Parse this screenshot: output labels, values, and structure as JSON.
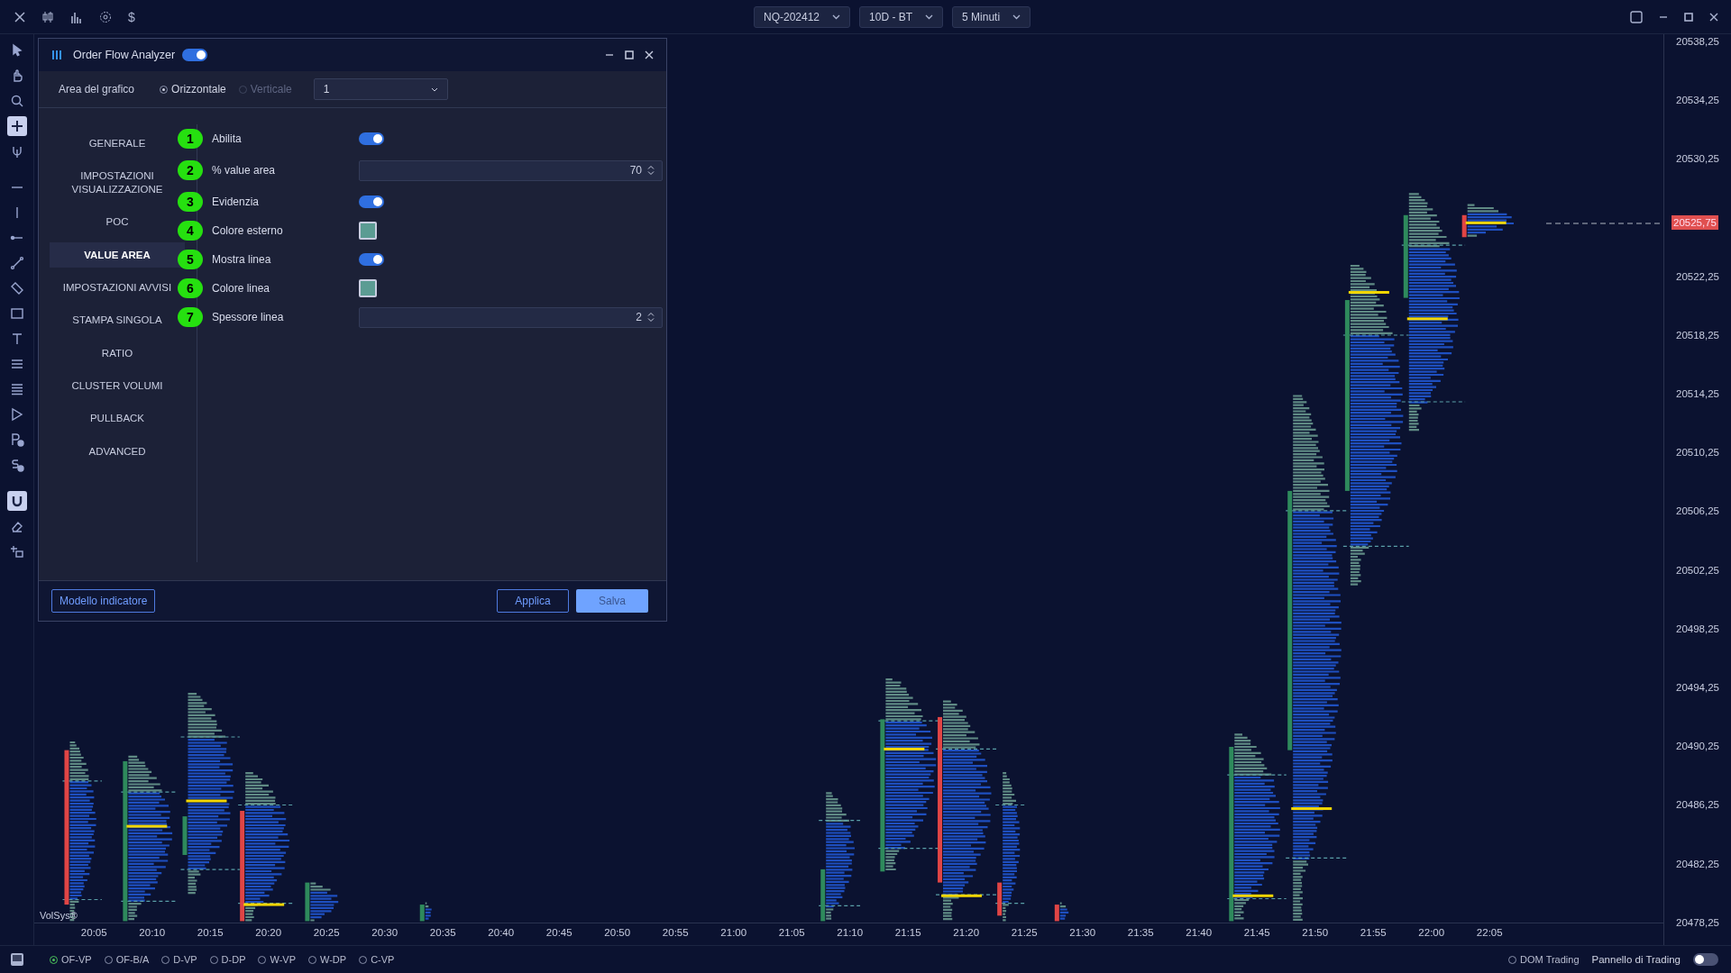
{
  "topbar": {
    "currency_symbol": "$",
    "selectors": [
      {
        "label": "NQ-202412"
      },
      {
        "label": "10D - BT"
      },
      {
        "label": "5 Minuti"
      }
    ]
  },
  "drawing_tools": [
    {
      "kind": "cursor",
      "selected": false
    },
    {
      "kind": "hand",
      "selected": false
    },
    {
      "kind": "zoom",
      "selected": false
    },
    {
      "kind": "crosshair",
      "selected": true
    },
    {
      "kind": "fork",
      "selected": false
    },
    {
      "kind": "hline",
      "selected": false
    },
    {
      "kind": "vline",
      "selected": false
    },
    {
      "kind": "ray",
      "selected": false
    },
    {
      "kind": "trendline",
      "selected": false
    },
    {
      "kind": "channel",
      "selected": false
    },
    {
      "kind": "rectangle",
      "selected": false
    },
    {
      "kind": "text",
      "selected": false
    },
    {
      "kind": "lines3",
      "selected": false
    },
    {
      "kind": "lines4",
      "selected": false
    },
    {
      "kind": "profile",
      "selected": false
    },
    {
      "kind": "price-note",
      "selected": false
    },
    {
      "kind": "s-note",
      "selected": false
    },
    {
      "kind": "magnet",
      "selected": true
    },
    {
      "kind": "eraser",
      "selected": false
    },
    {
      "kind": "clone",
      "selected": false
    }
  ],
  "dialog": {
    "title": "Order Flow Analyzer",
    "enabled": true,
    "area_label": "Area del grafico",
    "orientation": [
      {
        "label": "Orizzontale",
        "selected": true,
        "disabled": false
      },
      {
        "label": "Verticale",
        "selected": false,
        "disabled": true
      }
    ],
    "pane": "1",
    "sections": [
      {
        "label": "GENERALE",
        "selected": false
      },
      {
        "label": "IMPOSTAZIONI VISUALIZZAZIONE",
        "selected": false
      },
      {
        "label": "POC",
        "selected": false
      },
      {
        "label": "VALUE AREA",
        "selected": true
      },
      {
        "label": "IMPOSTAZIONI AVVISI",
        "selected": false
      },
      {
        "label": "STAMPA SINGOLA",
        "selected": false
      },
      {
        "label": "RATIO",
        "selected": false
      },
      {
        "label": "CLUSTER VOLUMI",
        "selected": false
      },
      {
        "label": "PULLBACK",
        "selected": false
      },
      {
        "label": "ADVANCED",
        "selected": false
      }
    ],
    "settings": [
      {
        "number": "1",
        "label": "Abilita",
        "kind": "toggle",
        "on": true
      },
      {
        "number": "2",
        "label": "% value area",
        "kind": "number",
        "value": "70"
      },
      {
        "number": "3",
        "label": "Evidenzia",
        "kind": "toggle",
        "on": true
      },
      {
        "number": "4",
        "label": "Colore esterno",
        "kind": "color",
        "color": "#5b9c93"
      },
      {
        "number": "5",
        "label": "Mostra linea",
        "kind": "toggle",
        "on": true
      },
      {
        "number": "6",
        "label": "Colore linea",
        "kind": "color",
        "color": "#5b9c93"
      },
      {
        "number": "7",
        "label": "Spessore linea",
        "kind": "number",
        "value": "2"
      }
    ],
    "footer": {
      "template_button": "Modello indicatore",
      "apply_button": "Applica",
      "save_button": "Salva"
    }
  },
  "chart": {
    "brand": "VolSys®",
    "price_tag": "20525,75",
    "y_ticks": [
      "20538,25",
      "20534,25",
      "20530,25",
      "20522,25",
      "20518,25",
      "20514,25",
      "20510,25",
      "20506,25",
      "20502,25",
      "20498,25",
      "20494,25",
      "20490,25",
      "20486,25",
      "20482,25",
      "20478,25"
    ],
    "x_ticks": [
      "20:05",
      "20:10",
      "20:15",
      "20:20",
      "20:25",
      "20:30",
      "20:35",
      "20:40",
      "20:45",
      "20:50",
      "20:55",
      "21:00",
      "21:05",
      "21:10",
      "21:15",
      "21:20",
      "21:25",
      "21:30",
      "21:35",
      "21:40",
      "21:45",
      "21:50",
      "21:55",
      "22:00",
      "22:05"
    ]
  },
  "bottom_bar": {
    "profiles": [
      {
        "label": "OF-VP",
        "selected": true
      },
      {
        "label": "OF-B/A",
        "selected": false
      },
      {
        "label": "D-VP",
        "selected": false
      },
      {
        "label": "D-DP",
        "selected": false
      },
      {
        "label": "W-VP",
        "selected": false
      },
      {
        "label": "W-DP",
        "selected": false
      },
      {
        "label": "C-VP",
        "selected": false
      }
    ],
    "dom_trading": {
      "label": "DOM Trading",
      "selected": false
    },
    "trading_panel": {
      "label": "Pannello di Trading",
      "on": false
    }
  }
}
